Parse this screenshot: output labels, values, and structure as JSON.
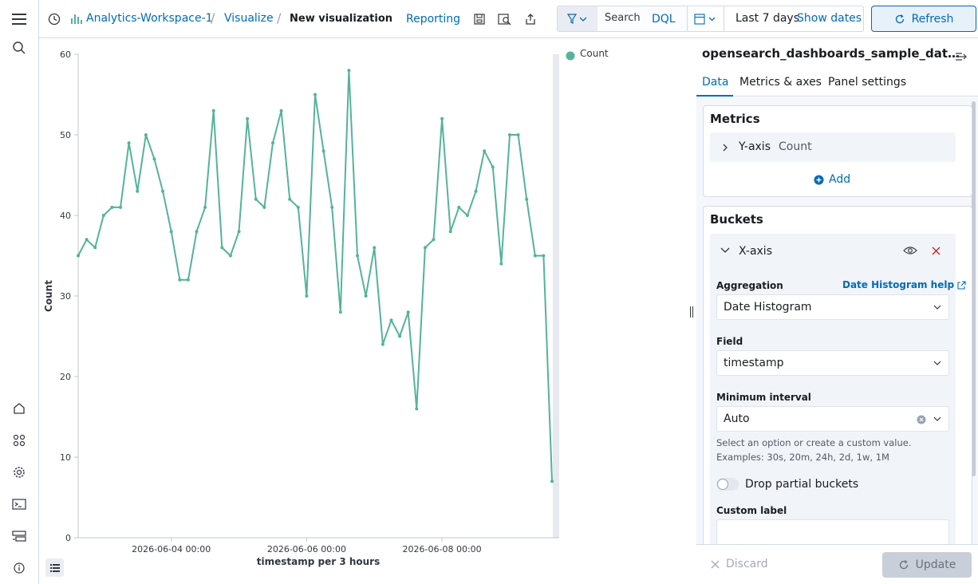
{
  "breadcrumb": {
    "workspace": "Analytics-Workspace-1",
    "section": "Visualize",
    "current": "New visualization"
  },
  "toolbar": {
    "reporting": "Reporting",
    "search_label": "Search",
    "query_lang": "DQL",
    "time_range": "Last 7 days",
    "show_dates": "Show dates",
    "refresh": "Refresh"
  },
  "panel": {
    "index_title": "opensearch_dashboards_sample_dat…",
    "tabs": [
      "Data",
      "Metrics & axes",
      "Panel settings"
    ],
    "metrics_title": "Metrics",
    "metric_axis": "Y-axis",
    "metric_name": "Count",
    "add_label": "Add",
    "buckets_title": "Buckets",
    "bucket_axis": "X-axis",
    "aggregation_label": "Aggregation",
    "aggregation_help": "Date Histogram help",
    "aggregation_value": "Date Histogram",
    "field_label": "Field",
    "field_value": "timestamp",
    "interval_label": "Minimum interval",
    "interval_value": "Auto",
    "interval_help_1": "Select an option or create a custom value.",
    "interval_help_2": "Examples: 30s, 20m, 24h, 2d, 1w, 1M",
    "drop_partial": "Drop partial buckets",
    "custom_label": "Custom label",
    "discard": "Discard",
    "update": "Update"
  },
  "colors": {
    "accent": "#006bb8",
    "series": "#54b399",
    "danger": "#bd271e"
  },
  "chart_data": {
    "type": "line",
    "xlabel": "timestamp per 3 hours",
    "ylabel": "Count",
    "ylim": [
      0,
      60
    ],
    "yticks": [
      0,
      10,
      20,
      30,
      40,
      50,
      60
    ],
    "xticks": [
      "2026-06-04 00:00",
      "2026-06-06 00:00",
      "2026-06-08 00:00"
    ],
    "xtick_index": [
      11,
      27,
      43
    ],
    "legend": "top-right",
    "series": [
      {
        "name": "Count",
        "values": [
          35,
          37,
          36,
          40,
          41,
          41,
          49,
          43,
          50,
          47,
          43,
          38,
          32,
          32,
          38,
          41,
          53,
          36,
          35,
          38,
          52,
          42,
          41,
          49,
          53,
          42,
          41,
          30,
          55,
          48,
          41,
          28,
          58,
          35,
          30,
          36,
          24,
          27,
          25,
          28,
          16,
          36,
          37,
          52,
          38,
          41,
          40,
          43,
          48,
          46,
          34,
          50,
          50,
          42,
          35,
          35,
          7
        ]
      }
    ]
  }
}
